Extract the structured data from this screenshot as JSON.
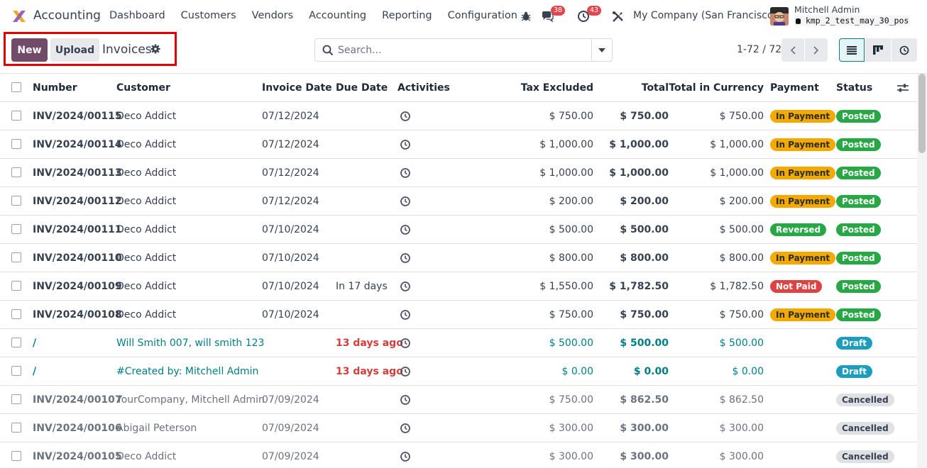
{
  "app": {
    "name": "Accounting",
    "menu": [
      "Dashboard",
      "Customers",
      "Vendors",
      "Accounting",
      "Reporting",
      "Configuration"
    ]
  },
  "systray": {
    "messages_count": "38",
    "activities_count": "43",
    "company": "My Company (San Francisco)",
    "user_name": "Mitchell Admin",
    "database": "kmp_2_test_may_30_pos"
  },
  "control_panel": {
    "new_label": "New",
    "upload_label": "Upload",
    "title": "Invoices",
    "search_placeholder": "Search...",
    "pager": "1-72 / 72"
  },
  "icons": {
    "logo": "accounting-logo-icon",
    "bug": "bug-icon",
    "chat": "chat-icon",
    "clock": "activity-clock-icon",
    "tools": "tools-icon",
    "gear": "gear-icon",
    "search": "search-icon",
    "caret": "caret-down-icon",
    "list": "list-view-icon",
    "kanban": "kanban-view-icon",
    "activity_view": "activity-view-icon"
  },
  "colors": {
    "primary": "#714b67",
    "teal": "#017e84",
    "in_payment": "#f2a900",
    "posted": "#28a745",
    "not_paid": "#dc4444",
    "draft": "#1c9dbd",
    "cancelled": "#dfe1e5"
  },
  "table": {
    "columns": [
      "Number",
      "Customer",
      "Invoice Date",
      "Due Date",
      "Activities",
      "Tax Excluded",
      "Total",
      "Total in Currency",
      "Payment",
      "Status"
    ],
    "rows": [
      {
        "number": "INV/2024/00115",
        "customer": "Deco Addict",
        "invoice_date": "07/12/2024",
        "due_date": "",
        "tax_excluded": "$ 750.00",
        "total": "$ 750.00",
        "total_currency": "$ 750.00",
        "payment": "In Payment",
        "status": "Posted"
      },
      {
        "number": "INV/2024/00114",
        "customer": "Deco Addict",
        "invoice_date": "07/12/2024",
        "due_date": "",
        "tax_excluded": "$ 1,000.00",
        "total": "$ 1,000.00",
        "total_currency": "$ 1,000.00",
        "payment": "In Payment",
        "status": "Posted"
      },
      {
        "number": "INV/2024/00113",
        "customer": "Deco Addict",
        "invoice_date": "07/12/2024",
        "due_date": "",
        "tax_excluded": "$ 1,000.00",
        "total": "$ 1,000.00",
        "total_currency": "$ 1,000.00",
        "payment": "In Payment",
        "status": "Posted"
      },
      {
        "number": "INV/2024/00112",
        "customer": "Deco Addict",
        "invoice_date": "07/12/2024",
        "due_date": "",
        "tax_excluded": "$ 200.00",
        "total": "$ 200.00",
        "total_currency": "$ 200.00",
        "payment": "In Payment",
        "status": "Posted"
      },
      {
        "number": "INV/2024/00111",
        "customer": "Deco Addict",
        "invoice_date": "07/10/2024",
        "due_date": "",
        "tax_excluded": "$ 500.00",
        "total": "$ 500.00",
        "total_currency": "$ 500.00",
        "payment": "Reversed",
        "status": "Posted"
      },
      {
        "number": "INV/2024/00110",
        "customer": "Deco Addict",
        "invoice_date": "07/10/2024",
        "due_date": "",
        "tax_excluded": "$ 800.00",
        "total": "$ 800.00",
        "total_currency": "$ 800.00",
        "payment": "In Payment",
        "status": "Posted"
      },
      {
        "number": "INV/2024/00109",
        "customer": "Deco Addict",
        "invoice_date": "07/10/2024",
        "due_date": "In 17 days",
        "tax_excluded": "$ 1,550.00",
        "total": "$ 1,782.50",
        "total_currency": "$ 1,782.50",
        "payment": "Not Paid",
        "status": "Posted"
      },
      {
        "number": "INV/2024/00108",
        "customer": "Deco Addict",
        "invoice_date": "07/10/2024",
        "due_date": "",
        "tax_excluded": "$ 750.00",
        "total": "$ 750.00",
        "total_currency": "$ 750.00",
        "payment": "In Payment",
        "status": "Posted"
      },
      {
        "number": "/",
        "customer": "Will Smith 007, will smith 123",
        "invoice_date": "",
        "due_date": "13 days ago",
        "tax_excluded": "$ 500.00",
        "total": "$ 500.00",
        "total_currency": "$ 500.00",
        "payment": "",
        "status": "Draft"
      },
      {
        "number": "/",
        "customer": "#Created by: Mitchell Admin",
        "invoice_date": "",
        "due_date": "13 days ago",
        "tax_excluded": "$ 0.00",
        "total": "$ 0.00",
        "total_currency": "$ 0.00",
        "payment": "",
        "status": "Draft"
      },
      {
        "number": "INV/2024/00107",
        "customer": "YourCompany, Mitchell Admin",
        "invoice_date": "07/09/2024",
        "due_date": "",
        "tax_excluded": "$ 750.00",
        "total": "$ 862.50",
        "total_currency": "$ 862.50",
        "payment": "",
        "status": "Cancelled"
      },
      {
        "number": "INV/2024/00106",
        "customer": "Abigail Peterson",
        "invoice_date": "07/09/2024",
        "due_date": "",
        "tax_excluded": "$ 300.00",
        "total": "$ 300.00",
        "total_currency": "$ 300.00",
        "payment": "",
        "status": "Cancelled"
      },
      {
        "number": "INV/2024/00105",
        "customer": "Deco Addict",
        "invoice_date": "07/09/2024",
        "due_date": "",
        "tax_excluded": "$ 300.00",
        "total": "$ 300.00",
        "total_currency": "$ 300.00",
        "payment": "",
        "status": "Cancelled"
      }
    ]
  }
}
